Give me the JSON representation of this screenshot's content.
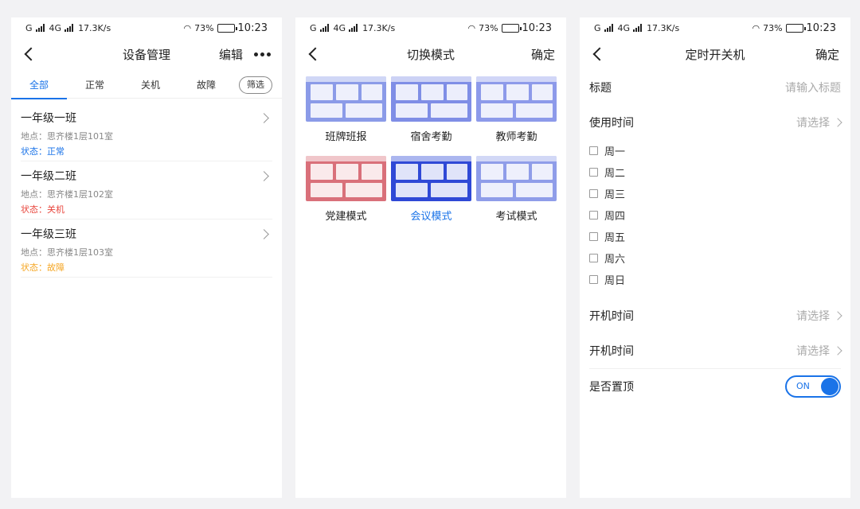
{
  "status_bar": {
    "network_left": "G",
    "network_mid": "4G",
    "speed": "17.3K/s",
    "battery": "73%",
    "battery_level": 0.73,
    "time": "10:23"
  },
  "screen1": {
    "title": "设备管理",
    "edit_label": "编辑",
    "tabs": [
      "全部",
      "正常",
      "关机",
      "故障"
    ],
    "active_tab": 0,
    "filter_label": "筛选",
    "devices": [
      {
        "name": "一年级一班",
        "location": "地点：思齐楼1层101室",
        "status": "状态：正常",
        "status_color": "#1a73e8"
      },
      {
        "name": "一年级二班",
        "location": "地点：思齐楼1层102室",
        "status": "状态：关机",
        "status_color": "#e8453c"
      },
      {
        "name": "一年级三班",
        "location": "地点：思齐楼1层103室",
        "status": "状态：故障",
        "status_color": "#f5a623"
      }
    ]
  },
  "screen2": {
    "title": "切换模式",
    "confirm_label": "确定",
    "modes": [
      {
        "label": "班牌班报",
        "color": "#8b9be8",
        "selected": false
      },
      {
        "label": "宿舍考勤",
        "color": "#7f8ee6",
        "selected": false
      },
      {
        "label": "教师考勤",
        "color": "#8d9aea",
        "selected": false
      },
      {
        "label": "党建模式",
        "color": "#d9707a",
        "selected": false
      },
      {
        "label": "会议模式",
        "color": "#2f49d6",
        "selected": true
      },
      {
        "label": "考试模式",
        "color": "#8f9de9",
        "selected": false
      }
    ]
  },
  "screen3": {
    "title": "定时开关机",
    "confirm_label": "确定",
    "title_field_label": "标题",
    "title_field_placeholder": "请输入标题",
    "use_time_label": "使用时间",
    "use_time_value": "请选择",
    "days": [
      "周一",
      "周二",
      "周三",
      "周四",
      "周五",
      "周六",
      "周日"
    ],
    "boot_time_label": "开机时间",
    "boot_time_value": "请选择",
    "boot_time2_label": "开机时间",
    "boot_time2_value": "请选择",
    "pin_label": "是否置顶",
    "pin_toggle": "ON"
  },
  "colors": {
    "accent": "#1a73e8",
    "placeholder": "#aaaaaa"
  }
}
